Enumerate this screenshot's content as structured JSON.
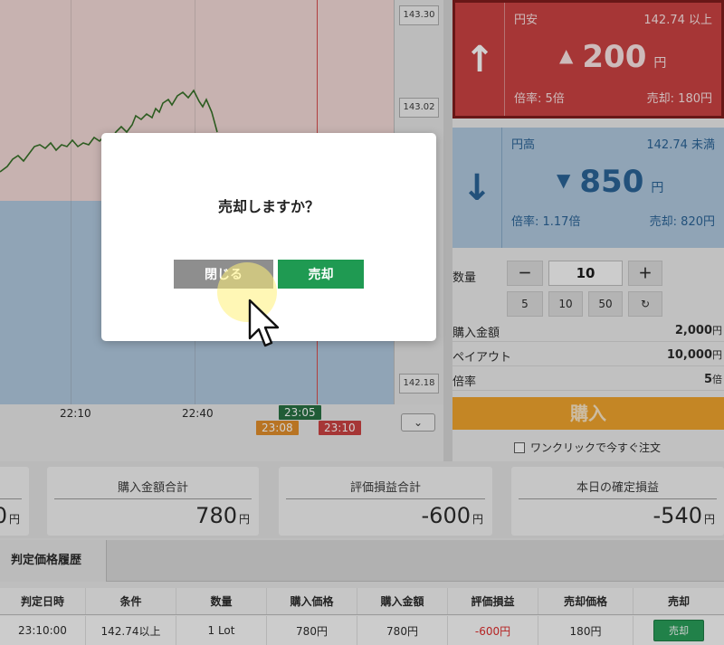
{
  "chart": {
    "price_labels": [
      "143.30",
      "143.02",
      "142.18"
    ],
    "time_labels": [
      "22:10",
      "22:40"
    ],
    "now_tag": "23:05",
    "tag_a": "23:08",
    "tag_b": "23:10",
    "colors": {
      "line": "#2e6b1e",
      "up_zone": "#f4d9d6",
      "down_zone": "#aec7de",
      "now_line": "#d64545"
    }
  },
  "card_up": {
    "arrow": "↑",
    "arrow_icon": "arrow-up-icon",
    "label": "円安",
    "strike": "142.74 以上",
    "price": "200",
    "unit": "円",
    "ratio": "倍率: 5倍",
    "sell": "売却: 180円"
  },
  "card_down": {
    "arrow": "↓",
    "arrow_icon": "arrow-down-icon",
    "label": "円高",
    "strike": "142.74 未満",
    "price": "850",
    "unit": "円",
    "ratio": "倍率: 1.17倍",
    "sell": "売却: 820円"
  },
  "quantity": {
    "label": "数量",
    "minus": "－",
    "value": "10",
    "plus": "＋",
    "presets": [
      "5",
      "10",
      "50"
    ],
    "reset": "↻"
  },
  "info": {
    "purchase_label": "購入金額",
    "purchase_value": "2,000",
    "purchase_unit": "円",
    "payout_label": "ペイアウト",
    "payout_value": "10,000",
    "payout_unit": "円",
    "ratio_label": "倍率",
    "ratio_value": "5",
    "ratio_unit": "倍"
  },
  "buy_button": "購入",
  "one_click": "ワンクリックで今すぐ注文",
  "summary": {
    "partial_value": "0",
    "partial_unit": "円",
    "total_purchase_title": "購入金額合計",
    "total_purchase_value": "780",
    "total_purchase_unit": "円",
    "eval_pl_title": "評価損益合計",
    "eval_pl_value": "-600",
    "eval_pl_unit": "円",
    "today_pl_title": "本日の確定損益",
    "today_pl_value": "-540",
    "today_pl_unit": "円"
  },
  "history": {
    "tab": "判定価格履歴",
    "headers": [
      "判定日時",
      "条件",
      "数量",
      "購入価格",
      "購入金額",
      "評価損益",
      "売却価格",
      "売却"
    ],
    "row": [
      "23:10:00",
      "142.74以上",
      "1 Lot",
      "780円",
      "780円",
      "-600円",
      "180円"
    ],
    "sell_button": "売却"
  },
  "modal": {
    "title": "売却しますか？",
    "close": "閉じる",
    "confirm": "売却"
  }
}
